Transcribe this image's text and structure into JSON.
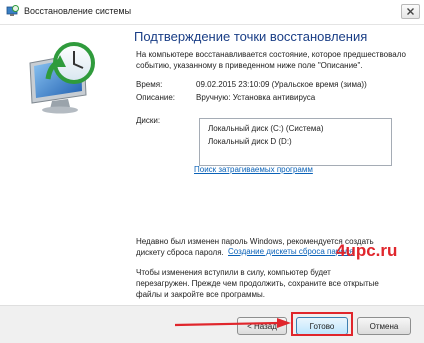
{
  "window": {
    "title": "Восстановление системы",
    "close_icon": "close-icon",
    "app_icon": "system-restore-icon"
  },
  "left_panel": {
    "icon": "system-restore-monitor-icon",
    "accent_color": "#2f9b3c"
  },
  "content": {
    "heading": "Подтверждение точки восстановления",
    "intro": "На компьютере восстанавливается состояние, которое предшествовало событию, указанному в приведенном ниже поле \"Описание\".",
    "time_label": "Время:",
    "time_value": "09.02.2015 23:10:09 (Уральское время (зима))",
    "description_label": "Описание:",
    "description_value": "Вручную: Установка антивируса",
    "disks_label": "Диски:",
    "disks": [
      "Локальный диск (C:) (Система)",
      "Локальный диск D (D:)"
    ],
    "affected_programs_link": "Поиск затрагиваемых программ",
    "password_notice": "Недавно был изменен пароль Windows, рекомендуется создать дискету сброса пароля.",
    "create_disk_link": "Создание дискеты сброса пароля",
    "restart_notice": "Чтобы изменения вступили в силу, компьютер будет перезагружен. Прежде чем продолжить, сохраните все открытые файлы и закройте все программы."
  },
  "buttons": {
    "back": "< Назад",
    "finish": "Готово",
    "cancel": "Отмена"
  },
  "watermark": "4upc.ru",
  "colors": {
    "heading": "#1a3e86",
    "link": "#0a62b8",
    "highlight": "#e0262c"
  }
}
